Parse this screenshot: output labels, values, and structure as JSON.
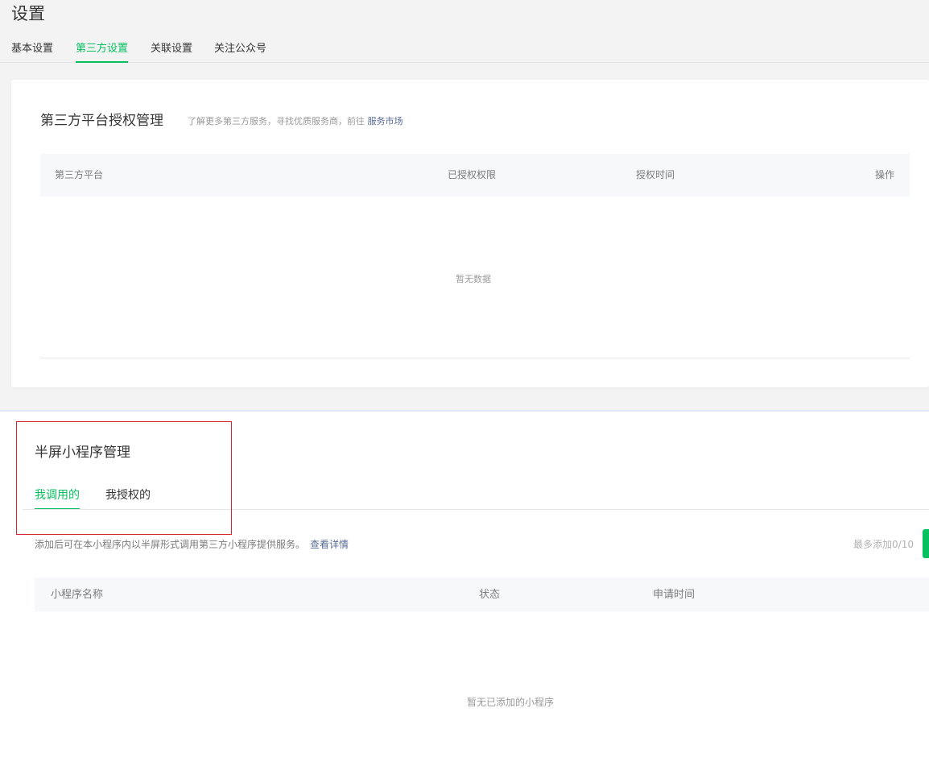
{
  "page": {
    "title": "设置"
  },
  "top_tabs": [
    {
      "label": "基本设置"
    },
    {
      "label": "第三方设置",
      "active": true
    },
    {
      "label": "关联设置"
    },
    {
      "label": "关注公众号"
    }
  ],
  "third_party": {
    "title": "第三方平台授权管理",
    "tip": "了解更多第三方服务，寻找优质服务商，前往",
    "tip_link": "服务市场",
    "columns": [
      "第三方平台",
      "已授权权限",
      "授权时间",
      "操作"
    ],
    "empty_text": "暂无数据"
  },
  "half_screen": {
    "title": "半屏小程序管理",
    "tabs": [
      {
        "label": "我调用的",
        "active": true
      },
      {
        "label": "我授权的"
      }
    ],
    "tip": "添加后可在本小程序内以半屏形式调用第三方小程序提供服务。",
    "tip_link": "查看详情",
    "limit_text": "最多添加0/10",
    "columns": [
      "小程序名称",
      "状态",
      "申请时间"
    ],
    "empty_text": "暂无已添加的小程序"
  },
  "colors": {
    "accent": "#07c160",
    "link": "#576b95",
    "highlight": "#d0262d"
  }
}
